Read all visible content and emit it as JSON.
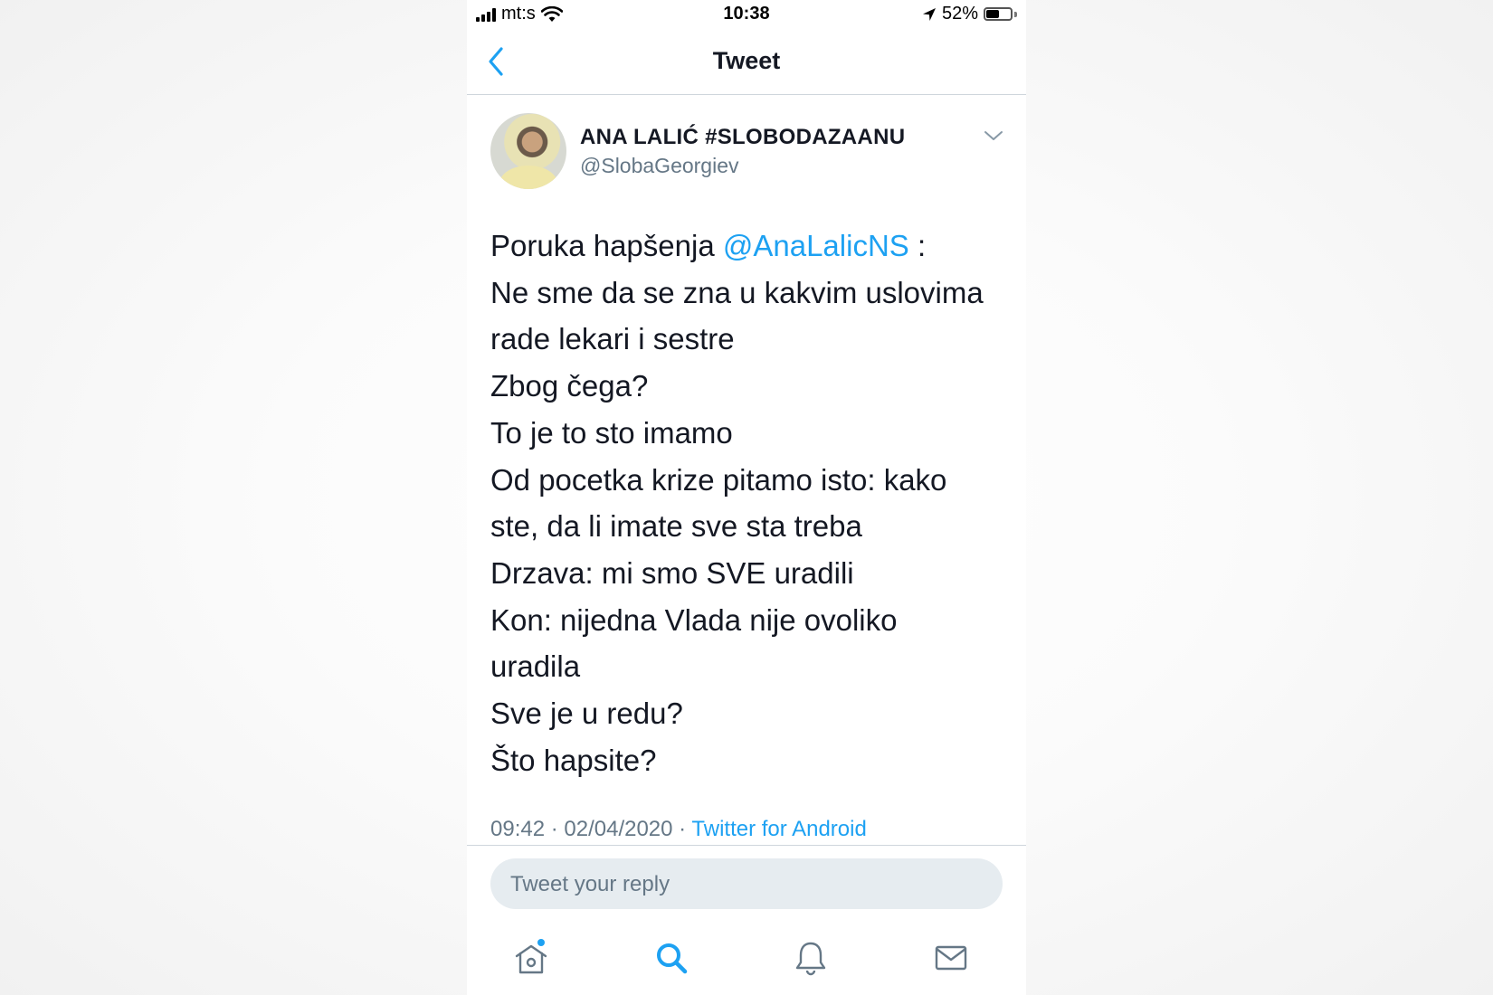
{
  "status_bar": {
    "carrier": "mt:s",
    "time": "10:38",
    "battery_percent": "52%",
    "battery_level": 0.52
  },
  "nav": {
    "title": "Tweet",
    "back_icon": "chevron-left-icon"
  },
  "tweet": {
    "author_name": "ANA LALIĆ #SLOBODAZAANU",
    "author_handle": "@SlobaGeorgiev",
    "body": {
      "line1_before": "Poruka hapšenja ",
      "mention": "@AnaLalicNS",
      "line1_after": " :",
      "lines": [
        "Ne sme da se zna u kakvim uslovima",
        "rade lekari i sestre",
        "Zbog čega?",
        "To je to sto imamo",
        "Od pocetka krize pitamo isto: kako",
        "ste, da li imate sve sta treba",
        "Drzava: mi smo SVE uradili",
        "Kon: nijedna Vlada nije ovoliko",
        "uradila",
        "Sve je u redu?",
        "Što hapsite?"
      ]
    },
    "timestamp": "09:42 · 02/04/2020 · ",
    "source": "Twitter for Android"
  },
  "reply": {
    "placeholder": "Tweet your reply"
  },
  "tab_bar": {
    "items": [
      "home-icon",
      "search-icon",
      "notifications-icon",
      "messages-icon"
    ],
    "active": "search-icon"
  },
  "colors": {
    "accent": "#1da1f2",
    "text": "#141823",
    "secondary": "#657786",
    "reply_bg": "#e6ecf0"
  }
}
